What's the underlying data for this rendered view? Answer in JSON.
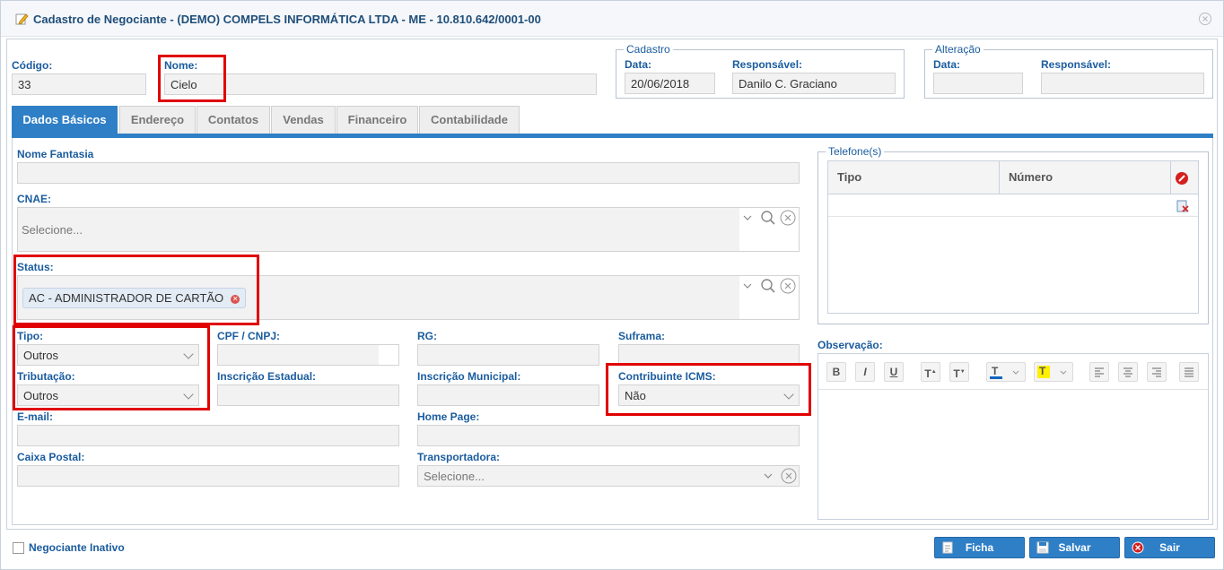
{
  "window": {
    "title": "Cadastro de Negociante - (DEMO) COMPELS INFORMÁTICA LTDA - ME - 10.810.642/0001-00"
  },
  "header": {
    "codigo_label": "Código:",
    "codigo_value": "33",
    "nome_label": "Nome:",
    "nome_value": "Cielo",
    "cadastro": {
      "legend": "Cadastro",
      "data_label": "Data:",
      "data_value": "20/06/2018",
      "resp_label": "Responsável:",
      "resp_value": "Danilo C. Graciano"
    },
    "alteracao": {
      "legend": "Alteração",
      "data_label": "Data:",
      "data_value": "",
      "resp_label": "Responsável:",
      "resp_value": ""
    }
  },
  "tabs": [
    "Dados Básicos",
    "Endereço",
    "Contatos",
    "Vendas",
    "Financeiro",
    "Contabilidade"
  ],
  "form": {
    "nome_fantasia_label": "Nome Fantasia",
    "cnae_label": "CNAE:",
    "cnae_placeholder": "Selecione...",
    "status_label": "Status:",
    "status_chip": "AC - ADMINISTRADOR DE CARTÃO",
    "tipo_label": "Tipo:",
    "tipo_value": "Outros",
    "cpf_label": "CPF / CNPJ:",
    "rg_label": "RG:",
    "suframa_label": "Suframa:",
    "tributacao_label": "Tributação:",
    "tributacao_value": "Outros",
    "ie_label": "Inscrição Estadual:",
    "im_label": "Inscrição Municipal:",
    "icms_label": "Contribuinte ICMS:",
    "icms_value": "Não",
    "email_label": "E-mail:",
    "homepage_label": "Home Page:",
    "caixa_label": "Caixa Postal:",
    "transportadora_label": "Transportadora:",
    "transportadora_placeholder": "Selecione..."
  },
  "telefones": {
    "legend": "Telefone(s)",
    "col_tipo": "Tipo",
    "col_numero": "Número"
  },
  "observacao_label": "Observação:",
  "footer": {
    "inativo_label": "Negociante Inativo",
    "ficha": "Ficha",
    "salvar": "Salvar",
    "sair": "Sair"
  },
  "icons": [
    "pencil-icon",
    "close-window-icon",
    "search-icon",
    "clear-icon",
    "chevron-down-icon",
    "delete-phone-icon",
    "edit-phone-icon",
    "ficha-icon",
    "save-icon",
    "exit-icon"
  ],
  "colors": {
    "accent": "#2f7fc6",
    "label": "#1a5c9e",
    "highlight": "#e00000"
  }
}
